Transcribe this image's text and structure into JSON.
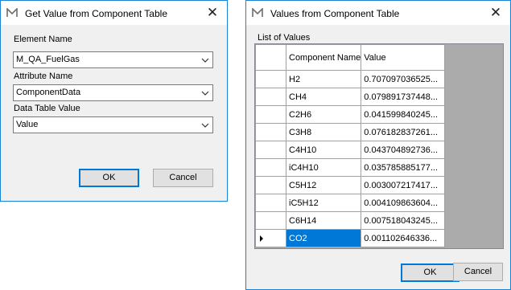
{
  "left_dialog": {
    "title": "Get Value from Component Table",
    "element_name_label": "Element Name",
    "element_name_value": "M_QA_FuelGas",
    "attribute_name_label": "Attribute Name",
    "attribute_name_value": "ComponentData",
    "data_table_value_label": "Data Table Value",
    "data_table_value_value": "Value",
    "ok_label": "OK",
    "cancel_label": "Cancel"
  },
  "right_dialog": {
    "title": "Values from Component Table",
    "list_label": "List of Values",
    "columns": [
      "Component Name",
      "Value"
    ],
    "rows": [
      {
        "component": "H2",
        "value": "0.707097036525..."
      },
      {
        "component": "CH4",
        "value": "0.079891737448..."
      },
      {
        "component": "C2H6",
        "value": "0.041599840245..."
      },
      {
        "component": "C3H8",
        "value": "0.076182837261..."
      },
      {
        "component": "C4H10",
        "value": "0.043704892736..."
      },
      {
        "component": "iC4H10",
        "value": "0.035785885177..."
      },
      {
        "component": "C5H12",
        "value": "0.003007217417..."
      },
      {
        "component": "iC5H12",
        "value": "0.004109863604..."
      },
      {
        "component": "C6H14",
        "value": "0.007518043245..."
      },
      {
        "component": "CO2",
        "value": "0.001102646336..."
      }
    ],
    "ok_label": "OK",
    "cancel_label": "Cancel"
  },
  "colors": {
    "accent": "#0078d7",
    "window_border": "#1883d7",
    "dialog_bg": "#f0f0f0",
    "grid_bg": "#ababab"
  },
  "icons": {
    "app": "app-logo-icon",
    "close": "close-icon",
    "dropdown": "chevron-down-icon",
    "row_pointer": "row-pointer-icon"
  }
}
